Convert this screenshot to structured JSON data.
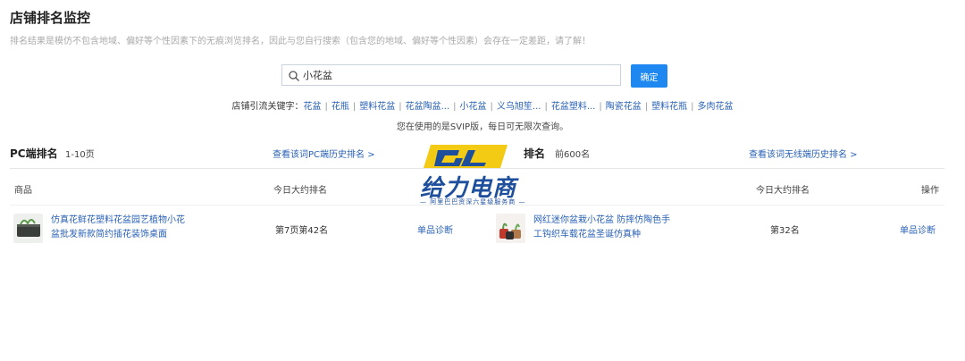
{
  "page": {
    "title": "店铺排名监控",
    "subtitle": "排名结果是模仿不包含地域、偏好等个性因素下的无痕浏览排名，因此与您自行搜索（包含您的地域、偏好等个性因素）会存在一定差距，请了解！"
  },
  "search": {
    "value": "小花盆",
    "button_label": "确定"
  },
  "keywords": {
    "label": "店铺引流关键字：",
    "items": [
      "花盆",
      "花瓶",
      "塑料花盆",
      "花盆陶盆...",
      "小花盆",
      "义乌旭笙...",
      "花盆塑料...",
      "陶瓷花盆",
      "塑料花瓶",
      "多肉花盆"
    ]
  },
  "svip_notice": "您在使用的是SVIP版，每日可无限次查询。",
  "pc_section": {
    "title": "PC端排名",
    "range": "1-10页",
    "history_link": "查看该词PC端历史排名 >"
  },
  "mobile_section": {
    "title_partial": "排名",
    "range": "前600名",
    "history_link": "查看该词无线端历史排名 >"
  },
  "columns": {
    "product": "商品",
    "daily_rank": "今日大约排名",
    "daily_rank_2": "今日大约排名",
    "action": "操作"
  },
  "rows": {
    "pc": {
      "name": "仿真花鲜花塑料花盆园艺植物小花盆批发新款简约插花装饰桌面",
      "rank": "第7页第42名",
      "diag": "单品诊断"
    },
    "mobile": {
      "name": "网红迷你盆栽小花盆 防摔仿陶色手工钩织车载花盆圣诞仿真种",
      "rank": "第32名",
      "diag": "单品诊断"
    }
  },
  "watermark": {
    "brand": "给力电商",
    "tagline": "— 阿里巴巴资深六星级服务商 —",
    "logo_text": "GL"
  },
  "colors": {
    "accent": "#1e88f0",
    "link": "#2a62b6",
    "watermark_yellow": "#f2c500",
    "watermark_blue": "#1e4f9c"
  }
}
